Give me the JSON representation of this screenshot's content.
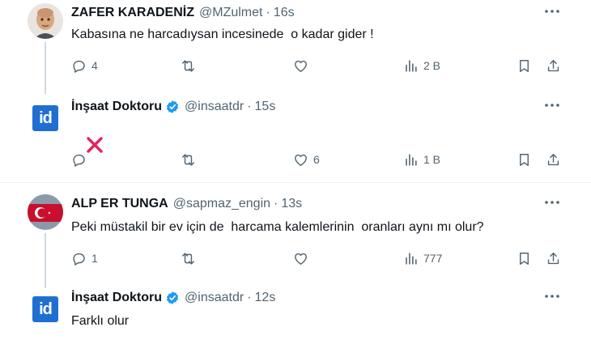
{
  "colors": {
    "text_primary": "#0f1419",
    "text_secondary": "#536471",
    "verified_blue": "#1d9bf0",
    "thread_line": "#cfd9de",
    "x_red": "#e0245e"
  },
  "tweets": [
    {
      "display_name": "ZAFER KARADENİZ",
      "handle": "@MZulmet",
      "separator": "·",
      "time": "16s",
      "text": "Kabasına ne harcadıysan incesinede  o kadar gider !",
      "replies": "4",
      "retweets": "",
      "likes": "",
      "views": "2 B",
      "avatar_icon": "memoji-avatar",
      "verified": false
    },
    {
      "display_name": "İnşaat Doktoru",
      "handle": "@insaatdr",
      "separator": "·",
      "time": "15s",
      "text_emoji": "cross-mark-emoji",
      "replies": "",
      "retweets": "",
      "likes": "6",
      "views": "1 B",
      "avatar_icon": "id-logo",
      "avatar_text": "id",
      "verified": true
    },
    {
      "display_name": "ALP ER TUNGA",
      "handle": "@sapmaz_engin",
      "separator": "·",
      "time": "13s",
      "text": "Peki müstakil bir ev için de  harcama kalemlerinin  oranları aynı mı olur?",
      "replies": "1",
      "retweets": "",
      "likes": "",
      "views": "777",
      "avatar_icon": "turkish-flag-avatar",
      "verified": false
    },
    {
      "display_name": "İnşaat Doktoru",
      "handle": "@insaatdr",
      "separator": "·",
      "time": "12s",
      "text": "Farklı olur",
      "avatar_icon": "id-logo",
      "avatar_text": "id",
      "verified": true
    }
  ]
}
